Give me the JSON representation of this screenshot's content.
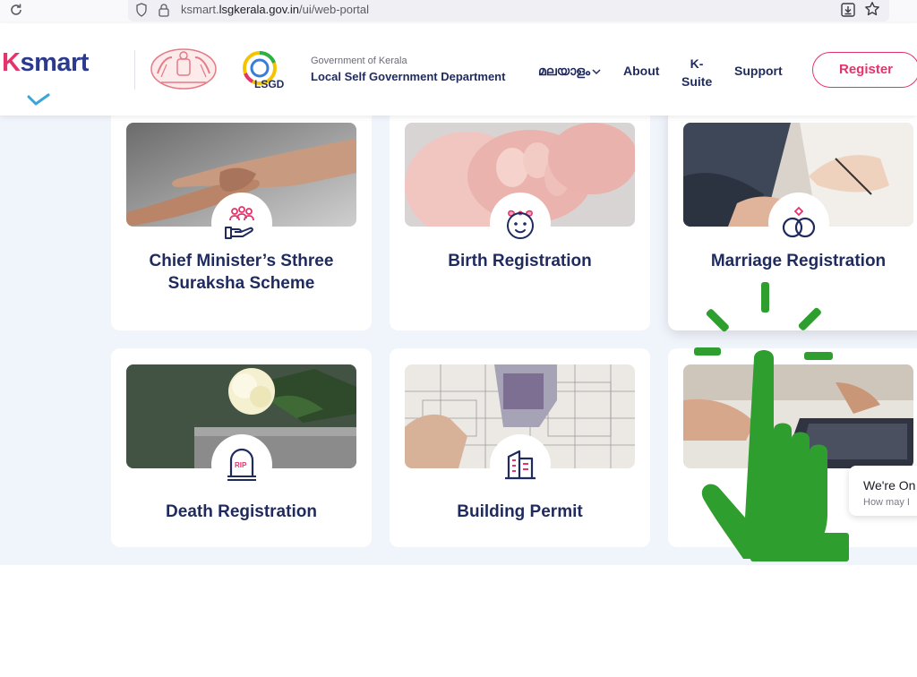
{
  "browser": {
    "url_prefix": "ksmart.",
    "url_domain": "lsgkerala.gov.in",
    "url_path": "/ui/web-portal"
  },
  "header": {
    "logo_k": "K",
    "logo_rest": "smart",
    "gov_line1": "Government of Kerala",
    "gov_line2": "Local Self Government Department",
    "nav": {
      "language": "മലയാളം",
      "about": "About",
      "ksuite_line1": "K-",
      "ksuite_line2": "Suite",
      "support": "Support",
      "register": "Register"
    },
    "lsgd_label": "LSGD"
  },
  "services": [
    {
      "title_line1": "Chief Minister’s Sthree",
      "title_line2": "Suraksha Scheme",
      "icon": "hand-people-icon"
    },
    {
      "title_line1": "Birth Registration",
      "title_line2": "",
      "icon": "baby-icon"
    },
    {
      "title_line1": "Marriage Registration",
      "title_line2": "",
      "icon": "rings-icon"
    },
    {
      "title_line1": "Death Registration",
      "title_line2": "",
      "icon": "tombstone-icon",
      "badge": "RIP"
    },
    {
      "title_line1": "Building Permit",
      "title_line2": "",
      "icon": "building-icon"
    },
    {
      "title_line1": "",
      "title_line2": "",
      "icon": ""
    }
  ],
  "chat": {
    "line1": "We're On",
    "line2": "How may I"
  },
  "colors": {
    "brand_pink": "#e5336b",
    "brand_navy": "#1f2a5e",
    "background": "#f0f4fb",
    "hand_green": "#2e9e2e"
  }
}
